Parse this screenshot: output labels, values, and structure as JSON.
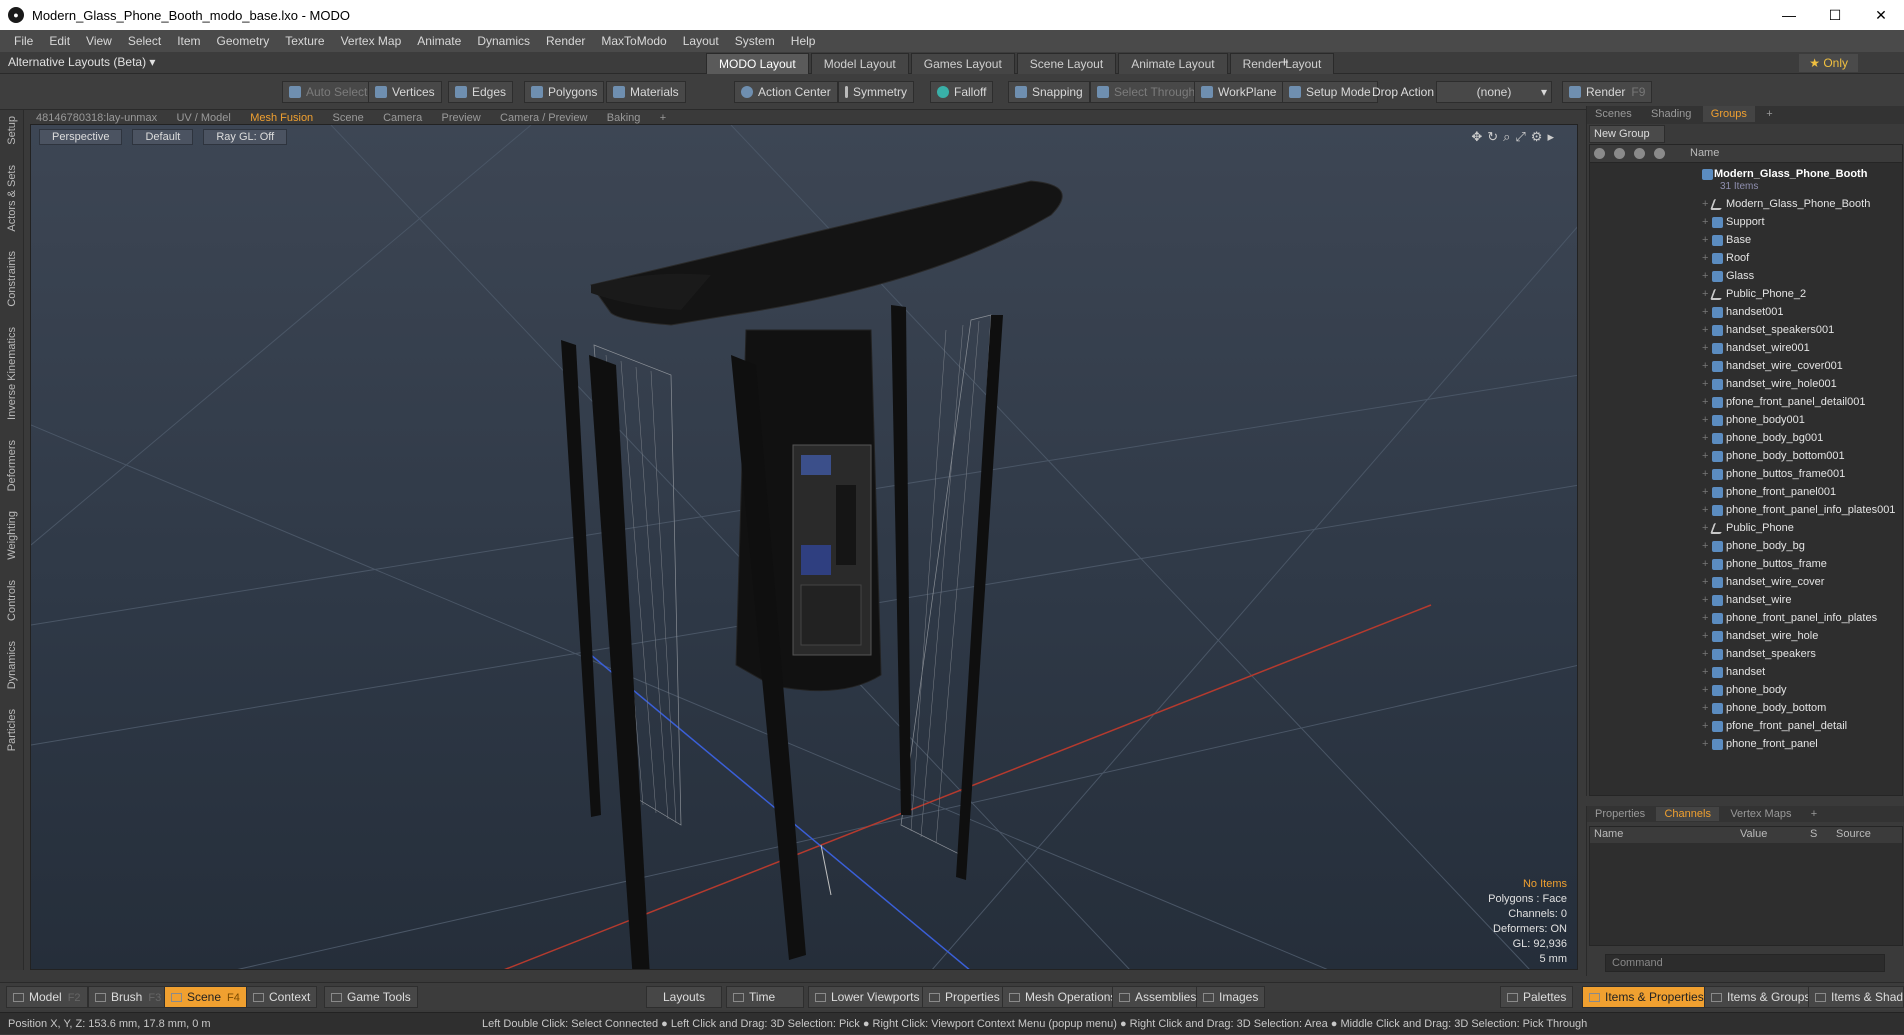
{
  "window": {
    "title": "Modern_Glass_Phone_Booth_modo_base.lxo - MODO",
    "min_label": "—",
    "max_label": "☐",
    "close_label": "✕"
  },
  "menu": [
    "File",
    "Edit",
    "View",
    "Select",
    "Item",
    "Geometry",
    "Texture",
    "Vertex Map",
    "Animate",
    "Dynamics",
    "Render",
    "MaxToModo",
    "Layout",
    "System",
    "Help"
  ],
  "layout_bar": {
    "alt_layouts": "Alternative Layouts (Beta) ▾",
    "tabs": [
      "MODO Layout",
      "Model Layout",
      "Games Layout",
      "Scene Layout",
      "Animate Layout",
      "Render Layout"
    ],
    "plus": "+",
    "only": "★ Only"
  },
  "toolbar": {
    "auto_select": "Auto Select",
    "vertices": "Vertices",
    "edges": "Edges",
    "polygons": "Polygons",
    "materials": "Materials",
    "action_center": "Action Center",
    "symmetry": "Symmetry",
    "falloff": "Falloff",
    "snapping": "Snapping",
    "select_through": "Select Through",
    "workplane": "WorkPlane",
    "setup_mode": "Setup Mode",
    "drop_action": "Drop Action",
    "drop_value": "(none)",
    "render": "Render",
    "render_key": "F9"
  },
  "left_strip": [
    "Setup",
    "Actors & Sets",
    "Constraints",
    "Inverse Kinematics",
    "Deformers",
    "Weighting",
    "Controls",
    "Dynamics",
    "Particles"
  ],
  "viewport_tabs": [
    "48146780318:lay-unmax",
    "UV / Model",
    "Mesh Fusion",
    "Scene",
    "Camera",
    "Preview",
    "Camera / Preview",
    "Baking",
    "+"
  ],
  "viewport": {
    "view": "Perspective",
    "shading": "Default",
    "raygl": "Ray GL: Off",
    "stats": {
      "items": "No Items",
      "polygons": "Polygons : Face",
      "channels": "Channels: 0",
      "deformers": "Deformers: ON",
      "gl": "GL: 92,936",
      "scale": "5 mm"
    }
  },
  "right_tabs": [
    "Scenes",
    "Shading",
    "Groups",
    "+"
  ],
  "groups": {
    "new_group": "New Group",
    "name_header": "Name",
    "root": "Modern_Glass_Phone_Booth",
    "root_count": "31 Items",
    "items": [
      {
        "name": "Modern_Glass_Phone_Booth",
        "type": "locator"
      },
      {
        "name": "Support",
        "type": "mesh"
      },
      {
        "name": "Base",
        "type": "mesh"
      },
      {
        "name": "Roof",
        "type": "mesh"
      },
      {
        "name": "Glass",
        "type": "mesh"
      },
      {
        "name": "Public_Phone_2",
        "type": "locator"
      },
      {
        "name": "handset001",
        "type": "mesh"
      },
      {
        "name": "handset_speakers001",
        "type": "mesh"
      },
      {
        "name": "handset_wire001",
        "type": "mesh"
      },
      {
        "name": "handset_wire_cover001",
        "type": "mesh"
      },
      {
        "name": "handset_wire_hole001",
        "type": "mesh"
      },
      {
        "name": "pfone_front_panel_detail001",
        "type": "mesh"
      },
      {
        "name": "phone_body001",
        "type": "mesh"
      },
      {
        "name": "phone_body_bg001",
        "type": "mesh"
      },
      {
        "name": "phone_body_bottom001",
        "type": "mesh"
      },
      {
        "name": "phone_buttos_frame001",
        "type": "mesh"
      },
      {
        "name": "phone_front_panel001",
        "type": "mesh"
      },
      {
        "name": "phone_front_panel_info_plates001",
        "type": "mesh"
      },
      {
        "name": "Public_Phone",
        "type": "locator"
      },
      {
        "name": "phone_body_bg",
        "type": "mesh"
      },
      {
        "name": "phone_buttos_frame",
        "type": "mesh"
      },
      {
        "name": "handset_wire_cover",
        "type": "mesh"
      },
      {
        "name": "handset_wire",
        "type": "mesh"
      },
      {
        "name": "phone_front_panel_info_plates",
        "type": "mesh"
      },
      {
        "name": "handset_wire_hole",
        "type": "mesh"
      },
      {
        "name": "handset_speakers",
        "type": "mesh"
      },
      {
        "name": "handset",
        "type": "mesh"
      },
      {
        "name": "phone_body",
        "type": "mesh"
      },
      {
        "name": "phone_body_bottom",
        "type": "mesh"
      },
      {
        "name": "pfone_front_panel_detail",
        "type": "mesh"
      },
      {
        "name": "phone_front_panel",
        "type": "mesh"
      }
    ]
  },
  "channels_tabs": [
    "Properties",
    "Channels",
    "Vertex Maps",
    "+"
  ],
  "channels_headers": {
    "name": "Name",
    "value": "Value",
    "s": "S",
    "source": "Source"
  },
  "command_placeholder": "Command",
  "bottom": {
    "model": "Model",
    "model_key": "F2",
    "brush": "Brush",
    "brush_key": "F3",
    "scene": "Scene",
    "scene_key": "F4",
    "context": "Context",
    "game_tools": "Game Tools",
    "layouts": "Layouts",
    "time": "Time",
    "lower_viewports": "Lower Viewports",
    "properties": "Properties",
    "mesh_operations": "Mesh Operations",
    "assemblies": "Assemblies",
    "images": "Images",
    "palettes": "Palettes",
    "items_properties": "Items & Properties",
    "items_groups": "Items & Groups",
    "items_shading": "Items & Shading"
  },
  "status": {
    "position": "Position X, Y, Z:   153.6 mm, 17.8 mm, 0 m",
    "hint": "Left Double Click: Select Connected ● Left Click and Drag: 3D Selection: Pick ● Right Click: Viewport Context Menu (popup menu) ● Right Click and Drag: 3D Selection: Area ● Middle Click and Drag: 3D Selection: Pick Through"
  },
  "colors": {
    "accent": "#f0a030",
    "viewport_top": "#3d4654",
    "viewport_bottom": "#252e3a",
    "axis_x": "#c0392b",
    "axis_z": "#3a5fd8"
  }
}
